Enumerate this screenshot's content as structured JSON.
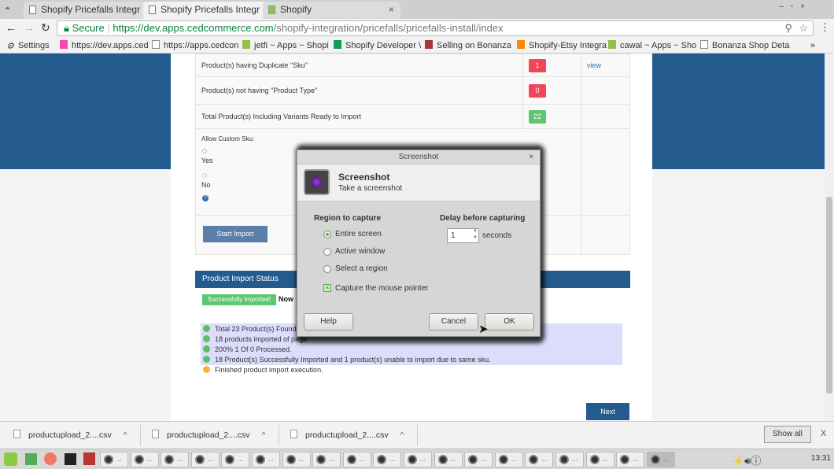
{
  "browser": {
    "tabs": [
      {
        "label": "Shopify Pricefalls Integr",
        "active": false
      },
      {
        "label": "Shopify Pricefalls Integr",
        "active": true
      },
      {
        "label": "Shopify",
        "active": false
      }
    ],
    "secure_label": "Secure",
    "url_host": "https://dev.apps.cedcommerce.com",
    "url_path": "/shopify-integration/pricefalls/pricefalls-install/index",
    "bookmarks": [
      "Settings",
      "https://dev.apps.ced",
      "https://apps.cedcon",
      "jetfi ~ Apps ~ Shopi",
      "Shopify Developer \\",
      "Selling on Bonanza",
      "Shopify-Etsy Integra",
      "cawal ~ Apps ~ Sho",
      "Bonanza Shop Deta"
    ],
    "bookmarks_more": "»"
  },
  "page": {
    "rows": [
      {
        "label": "Product(s) having Duplicate \"Sku\"",
        "count": "1",
        "color": "red",
        "action": "view"
      },
      {
        "label": "Product(s) not having \"Product Type\"",
        "count": "0",
        "color": "red",
        "action": ""
      },
      {
        "label": "Total Product(s) Including Variants Ready to Import",
        "count": "22",
        "color": "green",
        "action": ""
      }
    ],
    "custom_sku_label": "Allow Custom Sku:",
    "opt_yes": "Yes",
    "opt_no": "No",
    "help_glyph": "?",
    "start_import": "Start Import",
    "status_header": "Product Import Status",
    "success_badge": "Successfully Imported!",
    "success_after": "Now",
    "log": [
      "Total 23 Product(s) Found",
      "18 products imported of page",
      "200% 1 Of 0 Processed.",
      "18 Product(s) Successfully Imported and 1 product(s) unable to import due to same sku.",
      "Finished product import execution."
    ],
    "next": "Next"
  },
  "dialog": {
    "title": "Screenshot",
    "heading": "Screenshot",
    "subheading": "Take a screenshot",
    "region_label": "Region to capture",
    "options": [
      "Entire screen",
      "Active window",
      "Select a region"
    ],
    "selected": "Entire screen",
    "pointer_label": "Capture the mouse pointer",
    "pointer_checked": true,
    "delay_label": "Delay before capturing",
    "delay_value": "1",
    "delay_unit": "seconds",
    "help": "Help",
    "cancel": "Cancel",
    "ok": "OK"
  },
  "downloads": {
    "items": [
      "productupload_2....csv",
      "productupload_2....csv",
      "productupload_2....csv"
    ],
    "show_all": "Show all",
    "close": "X"
  },
  "taskbar": {
    "clock": "13:31",
    "ellipsis": "..."
  }
}
